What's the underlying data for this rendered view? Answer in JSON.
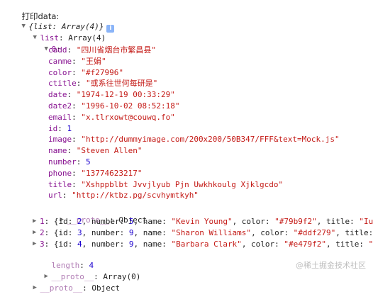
{
  "console": {
    "prefix": "打印data:",
    "root_summary": "{list: Array(4)}",
    "info_glyph": "i",
    "list_key": "list",
    "list_type": "Array(4)",
    "item0_index": "0",
    "item0_fields": [
      {
        "key": "cadd",
        "value": "\"四川省烟台市繁昌县\"",
        "type": "string"
      },
      {
        "key": "canme",
        "value": "\"王娟\"",
        "type": "string"
      },
      {
        "key": "color",
        "value": "\"#f27996\"",
        "type": "string"
      },
      {
        "key": "ctitle",
        "value": "\"或系往世何每研是\"",
        "type": "string"
      },
      {
        "key": "date",
        "value": "\"1974-12-19 00:33:29\"",
        "type": "string"
      },
      {
        "key": "date2",
        "value": "\"1996-10-02 08:52:18\"",
        "type": "string"
      },
      {
        "key": "email",
        "value": "\"x.tlrxowt@couwq.fo\"",
        "type": "string"
      },
      {
        "key": "id",
        "value": "1",
        "type": "number"
      },
      {
        "key": "image",
        "value": "\"http://dummyimage.com/200x200/50B347/FFF&text=Mock.js\"",
        "type": "string"
      },
      {
        "key": "name",
        "value": "\"Steven Allen\"",
        "type": "string"
      },
      {
        "key": "number",
        "value": "5",
        "type": "number"
      },
      {
        "key": "phone",
        "value": "\"13774623217\"",
        "type": "string"
      },
      {
        "key": "title",
        "value": "\"Xshppblbt Jvvjlyub Pjn Uwkhkoulg Xjklgcdo\"",
        "type": "string"
      },
      {
        "key": "url",
        "value": "\"http://ktbz.pg/scvhymtkyh\"",
        "type": "string"
      }
    ],
    "proto_key": "__proto__",
    "proto_object": "Object",
    "collapsed_items": [
      {
        "index": "1",
        "id": "2",
        "number": "5",
        "name": "\"Kevin Young\"",
        "color": "\"#79b9f2\"",
        "title": "\"Iu"
      },
      {
        "index": "2",
        "id": "3",
        "number": "9",
        "name": "\"Sharon Williams\"",
        "color": "\"#ddf279\"",
        "title": "\""
      },
      {
        "index": "3",
        "id": "4",
        "number": "9",
        "name": "\"Barbara Clark\"",
        "color": "\"#e479f2\"",
        "title": "\""
      }
    ],
    "length_key": "length",
    "length_value": "4",
    "array_proto": "Array(0)"
  },
  "watermark": "@稀土掘金技术社区",
  "colors": {
    "key": "#881391",
    "string": "#c41a16",
    "number": "#1c00cf"
  }
}
